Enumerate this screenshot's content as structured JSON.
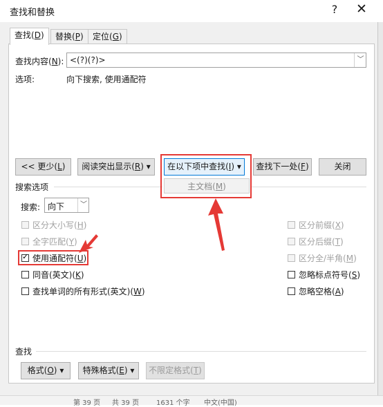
{
  "title": "查找和替换",
  "titlebar": {
    "help_glyph": "?",
    "close_glyph": "✕"
  },
  "tabs": [
    {
      "prefix": "查找(",
      "key": "D",
      "suffix": ")",
      "active": true
    },
    {
      "prefix": "替换(",
      "key": "P",
      "suffix": ")",
      "active": false
    },
    {
      "prefix": "定位(",
      "key": "G",
      "suffix": ")",
      "active": false
    }
  ],
  "find_field": {
    "label_prefix": "查找内容(",
    "label_key": "N",
    "label_suffix": "):",
    "value": "<(?)(?)>"
  },
  "options_line": {
    "label": "选项:",
    "value": "向下搜索, 使用通配符"
  },
  "buttons": {
    "less": {
      "prefix": "<< 更少(",
      "key": "L",
      "suffix": ")"
    },
    "reading_highlight": {
      "prefix": "阅读突出显示(",
      "key": "R",
      "suffix": ")",
      "arrow": "▾"
    },
    "find_in": {
      "prefix": "在以下项中查找(",
      "key": "I",
      "suffix": ")",
      "arrow": "▾"
    },
    "find_next": {
      "prefix": "查找下一处(",
      "key": "F",
      "suffix": ")"
    },
    "close": {
      "label": "关闭"
    }
  },
  "find_in_menu": {
    "item_prefix": "主文档(",
    "item_key": "M",
    "item_suffix": ")"
  },
  "search_options": {
    "header": "搜索选项",
    "search_label_prefix": "搜索",
    "search_label_suffix": ":",
    "search_value": "向下",
    "left": [
      {
        "prefix": "区分大小写(",
        "key": "H",
        "suffix": ")",
        "checked": false,
        "disabled": true
      },
      {
        "prefix": "全字匹配(",
        "key": "Y",
        "suffix": ")",
        "checked": false,
        "disabled": true
      },
      {
        "prefix": "使用通配符(",
        "key": "U",
        "suffix": ")",
        "checked": true,
        "disabled": false
      },
      {
        "prefix": "同音(英文)(",
        "key": "K",
        "suffix": ")",
        "checked": false,
        "disabled": false
      },
      {
        "prefix": "查找单词的所有形式(英文)(",
        "key": "W",
        "suffix": ")",
        "checked": false,
        "disabled": false
      }
    ],
    "right": [
      {
        "prefix": "区分前缀(",
        "key": "X",
        "suffix": ")",
        "checked": false,
        "disabled": true
      },
      {
        "prefix": "区分后缀(",
        "key": "T",
        "suffix": ")",
        "checked": false,
        "disabled": true
      },
      {
        "prefix": "区分全/半角(",
        "key": "M",
        "suffix": ")",
        "checked": false,
        "disabled": true
      },
      {
        "prefix": "忽略标点符号(",
        "key": "S",
        "suffix": ")",
        "checked": false,
        "disabled": false
      },
      {
        "prefix": "忽略空格(",
        "key": "A",
        "suffix": ")",
        "checked": false,
        "disabled": false
      }
    ]
  },
  "find_section": {
    "header": "查找",
    "format": {
      "prefix": "格式(",
      "key": "O",
      "suffix": ")",
      "arrow": "▾"
    },
    "special": {
      "prefix": "特殊格式(",
      "key": "E",
      "suffix": ")",
      "arrow": "▾"
    },
    "no_format": {
      "prefix": "不限定格式(",
      "key": "T",
      "suffix": ")"
    }
  },
  "status_bar": {
    "page": "第 39 页",
    "total": "共 39 页",
    "words": "1631 个字",
    "lang": "中文(中国)"
  },
  "accent_colors": {
    "annotation_red": "#e53935",
    "focus_blue": "#0078d7"
  }
}
